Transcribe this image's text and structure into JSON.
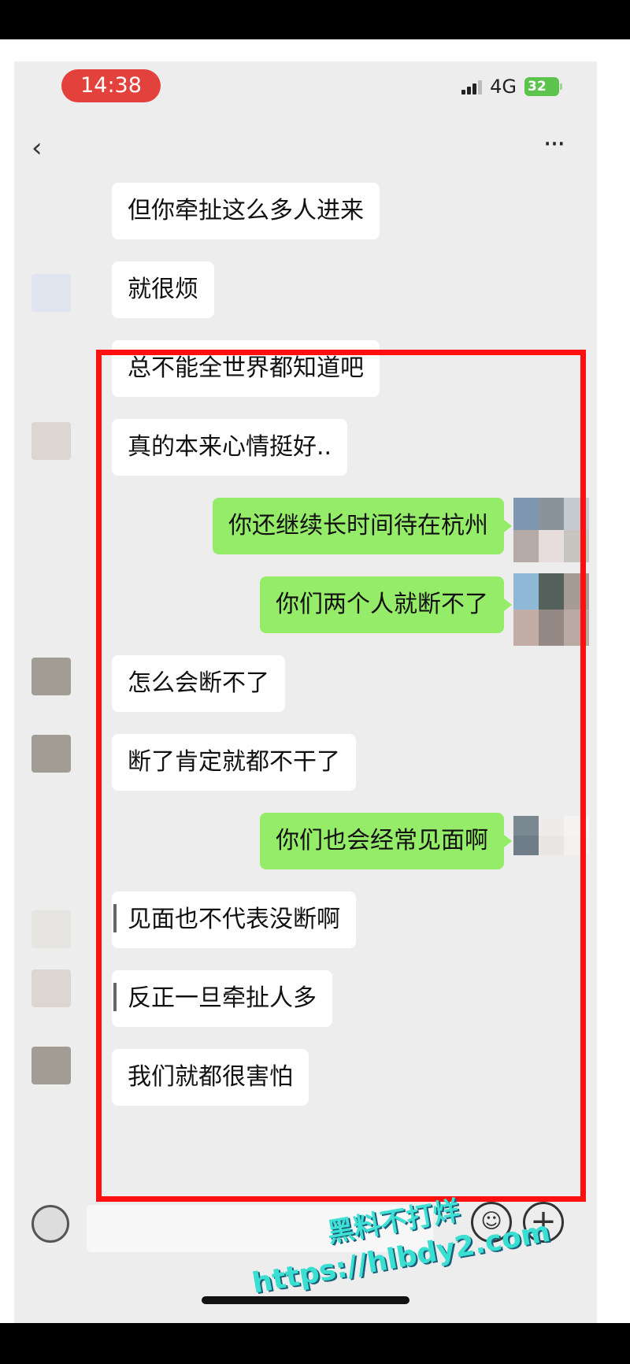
{
  "status_bar": {
    "time": "14:38",
    "network": "4G",
    "battery": "32"
  },
  "header": {
    "back_icon": "chevron-left-icon",
    "more_icon": "more-icon"
  },
  "messages": [
    {
      "side": "left",
      "text": "但你牵扯这么多人进来"
    },
    {
      "side": "left",
      "text": "就很烦"
    },
    {
      "side": "left",
      "text": "总不能全世界都知道吧"
    },
    {
      "side": "left",
      "text": "真的本来心情挺好.."
    },
    {
      "side": "right",
      "text": "你还继续长时间待在杭州"
    },
    {
      "side": "right",
      "text": "你们两个人就断不了"
    },
    {
      "side": "left",
      "text": "怎么会断不了"
    },
    {
      "side": "left",
      "text": "断了肯定就都不干了"
    },
    {
      "side": "right",
      "text": "你们也会经常见面啊"
    },
    {
      "side": "left",
      "text": "见面也不代表没断啊"
    },
    {
      "side": "left",
      "text": "反正一旦牵扯人多"
    },
    {
      "side": "left",
      "text": "我们就都很害怕"
    }
  ],
  "bottom_bar": {
    "emoji_icon": "emoji-icon",
    "plus_icon": "plus-icon",
    "plus_symbol": "+",
    "emoji_symbol": "☺"
  },
  "watermark": {
    "title": "黑料不打烊",
    "url": "https://hlbdy2.com"
  },
  "colors": {
    "highlight_border": "#ff1010",
    "sent_bubble": "#95ec69",
    "received_bubble": "#ffffff",
    "time_pill": "#e3413b",
    "battery": "#5cc34d",
    "watermark": "#3ee2d5"
  }
}
